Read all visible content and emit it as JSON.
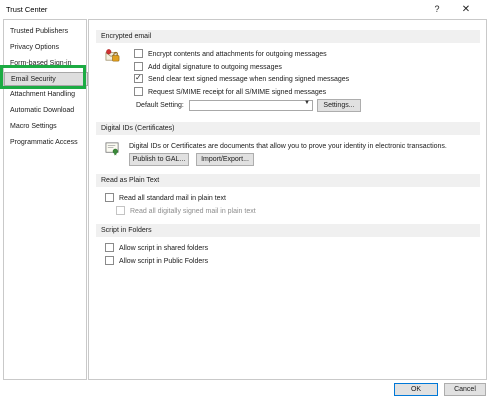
{
  "window": {
    "title": "Trust Center",
    "help_icon": "?",
    "close_icon": "✕"
  },
  "sidebar": {
    "items": [
      {
        "label": "Trusted Publishers"
      },
      {
        "label": "Privacy Options"
      },
      {
        "label": "Form-based Sign-in"
      },
      {
        "label": "Email Security"
      },
      {
        "label": "Attachment Handling"
      },
      {
        "label": "Automatic Download"
      },
      {
        "label": "Macro Settings"
      },
      {
        "label": "Programmatic Access"
      }
    ],
    "selected": "Email Security"
  },
  "encrypted_email": {
    "heading": "Encrypted email",
    "options": [
      {
        "label": "Encrypt contents and attachments for outgoing messages",
        "checked": false
      },
      {
        "label": "Add digital signature to outgoing messages",
        "checked": false
      },
      {
        "label": "Send clear text signed message when sending signed messages",
        "checked": true
      },
      {
        "label": "Request S/MIME receipt for all S/MIME signed messages",
        "checked": false
      }
    ],
    "default_setting_label": "Default Setting:",
    "default_setting_value": "",
    "settings_button": "Settings..."
  },
  "digital_ids": {
    "heading": "Digital IDs (Certificates)",
    "description": "Digital IDs or Certificates are documents that allow you to prove your identity in electronic transactions.",
    "publish_button": "Publish to GAL...",
    "import_export_button": "Import/Export..."
  },
  "read_plain_text": {
    "heading": "Read as Plain Text",
    "read_all_label": "Read all standard mail in plain text",
    "read_all_checked": false,
    "read_signed_label": "Read all digitally signed mail in plain text",
    "read_signed_checked": false
  },
  "script_in_folders": {
    "heading": "Script in Folders",
    "shared_label": "Allow script in shared folders",
    "shared_checked": false,
    "public_label": "Allow script in Public Folders",
    "public_checked": false
  },
  "footer": {
    "ok": "OK",
    "cancel": "Cancel"
  },
  "colors": {
    "highlight": "#1cab43",
    "section_bg": "#f0f0f0",
    "accent": "#0078d7"
  }
}
